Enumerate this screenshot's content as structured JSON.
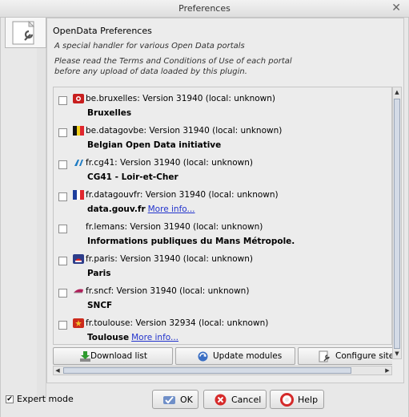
{
  "window": {
    "title": "Preferences",
    "close_glyph": "✕"
  },
  "panel": {
    "heading": "OpenData Preferences",
    "desc1": "A special handler for various Open Data portals",
    "desc2a": "Please read the Terms and Conditions of Use of each portal",
    "desc2b": "before any upload of data loaded by this plugin."
  },
  "modules": [
    {
      "name": "be.bruxelles: Version 31940 (local: unknown)",
      "subtitle": "Bruxelles",
      "more": "",
      "icon": "bruxelles-icon"
    },
    {
      "name": "be.datagovbe: Version 31940 (local: unknown)",
      "subtitle": "Belgian Open Data initiative",
      "more": "",
      "icon": "belgium-flag-icon"
    },
    {
      "name": "fr.cg41: Version 31940 (local: unknown)",
      "subtitle": "CG41 - Loir-et-Cher",
      "more": "",
      "icon": "cg41-icon"
    },
    {
      "name": "fr.datagouvfr: Version 31940 (local: unknown)",
      "subtitle": "data.gouv.fr",
      "more": "More info...",
      "icon": "france-flag-icon"
    },
    {
      "name": "fr.lemans: Version 31940 (local: unknown)",
      "subtitle": "Informations publiques du Mans Métropole.",
      "more": "",
      "icon": ""
    },
    {
      "name": "fr.paris: Version 31940 (local: unknown)",
      "subtitle": "Paris",
      "more": "",
      "icon": "paris-icon"
    },
    {
      "name": "fr.sncf: Version 31940 (local: unknown)",
      "subtitle": "SNCF",
      "more": "",
      "icon": "sncf-icon"
    },
    {
      "name": "fr.toulouse: Version 32934 (local: unknown)",
      "subtitle": "Toulouse",
      "more": "More info...",
      "icon": "toulouse-icon"
    }
  ],
  "toolbar": {
    "download": "Download list",
    "update": "Update modules",
    "configure": "Configure site"
  },
  "footer": {
    "expert_mode": "Expert mode",
    "expert_checked": true,
    "ok": "OK",
    "cancel": "Cancel",
    "help": "Help"
  },
  "colors": {
    "link": "#2233cc",
    "accent": "#cc2020"
  }
}
